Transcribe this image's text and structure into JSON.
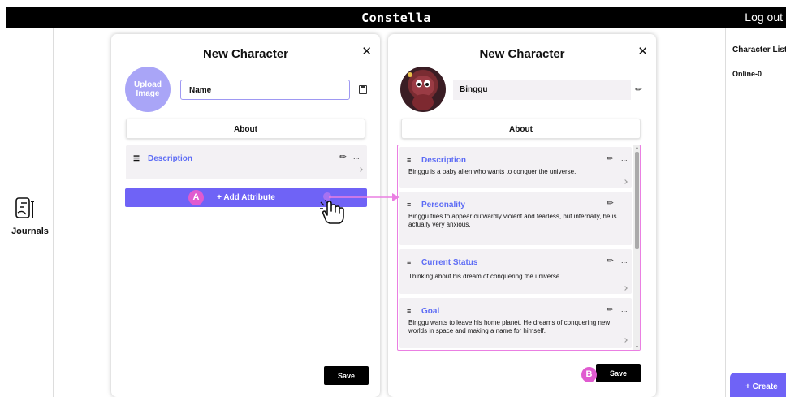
{
  "app": {
    "title": "Constella",
    "logout_label": "Log out"
  },
  "left_nav": {
    "journals_label": "Journals",
    "journals_icon": "journal-icon"
  },
  "right_nav": {
    "title": "Character List",
    "online_label": "Online-0",
    "create_label": "+ Create"
  },
  "left_panel": {
    "title": "New Character",
    "close_label": "✕",
    "upload_label": [
      "Upload",
      "Image"
    ],
    "name_value": "Name",
    "about_label": "About",
    "attribute": {
      "title": "Description",
      "more": "..."
    },
    "add_attribute_label": "+ Add Attribute",
    "save_label": "Save"
  },
  "right_panel": {
    "title": "New Character",
    "close_label": "✕",
    "name_value": "Binggu",
    "about_label": "About",
    "attributes": [
      {
        "title": "Description",
        "text": "Binggu is a baby alien who wants to conquer the universe."
      },
      {
        "title": "Personality",
        "text": "Binggu tries to appear outwardly violent and fearless, but internally, he is actually very anxious."
      },
      {
        "title": "Current Status",
        "text": "Thinking about his dream of conquering the universe."
      },
      {
        "title": "Goal",
        "text": "Binggu wants to leave his home planet. He dreams of conquering new worlds in space and making a name for himself."
      }
    ],
    "more": "...",
    "save_label": "Save"
  },
  "annotations": {
    "a": "A",
    "b": "B"
  },
  "colors": {
    "accent": "#6f63f6",
    "attribute_title": "#5d6cf5",
    "highlight": "#ea7fe2",
    "badge": "#e05bd0"
  }
}
